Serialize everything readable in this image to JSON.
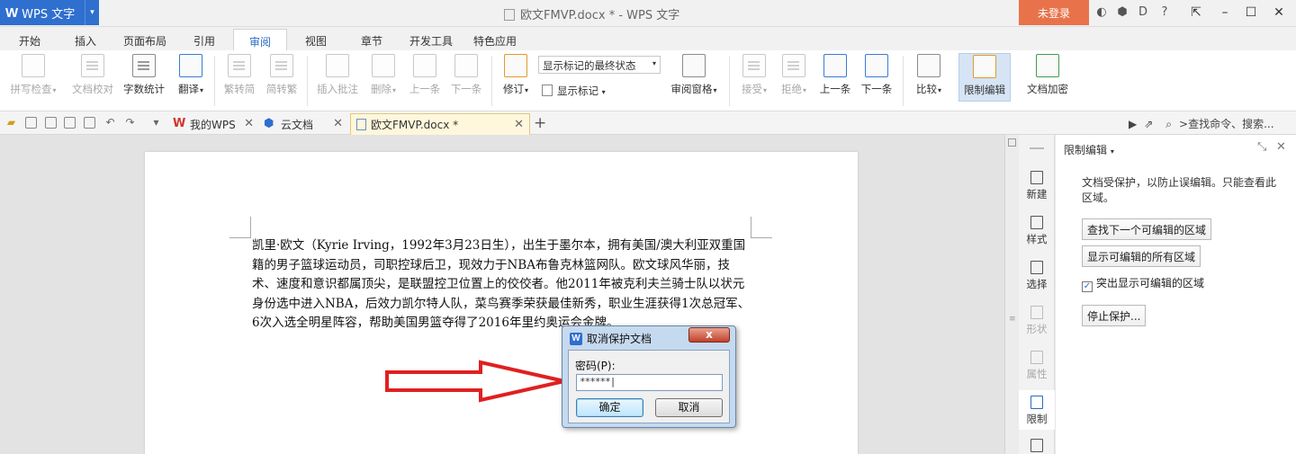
{
  "app": {
    "name": "WPS 文字",
    "logo": "W"
  },
  "window": {
    "title": "欧文FMVP.docx * - WPS 文字",
    "login": "未登录"
  },
  "menu": [
    "开始",
    "插入",
    "页面布局",
    "引用",
    "审阅",
    "视图",
    "章节",
    "开发工具",
    "特色应用"
  ],
  "menu_active": "审阅",
  "ribbon": {
    "spell": "拼写检查",
    "proof": "文档校对",
    "wordcount": "字数统计",
    "translate": "翻译",
    "to_simplified": "繁转简",
    "to_traditional": "简转繁",
    "insert_comment": "插入批注",
    "delete": "删除",
    "prev_comment": "上一条",
    "next_comment": "下一条",
    "revise": "修订",
    "display_state": "显示标记的最终状态",
    "show_markup": "显示标记",
    "review_pane": "审阅窗格",
    "accept": "接受",
    "reject": "拒绝",
    "prev_change": "上一条",
    "next_change": "下一条",
    "compare": "比较",
    "restrict_edit": "限制编辑",
    "encrypt": "文档加密"
  },
  "tabs": {
    "my_wps": "我的WPS",
    "cloud": "云文档",
    "doc": "欧文FMVP.docx *",
    "search": ">查找命令、搜索..."
  },
  "document": {
    "paragraph": "凯里·欧文（Kyrie Irving，1992年3月23日生），出生于墨尔本，拥有美国/澳大利亚双重国籍的男子篮球运动员，司职控球后卫，现效力于NBA布鲁克林篮网队。欧文球风华丽，技术、速度和意识都属顶尖，是联盟控卫位置上的佼佼者。他2011年被克利夫兰骑士队以状元身份选中进入NBA，后效力凯尔特人队，菜鸟赛季荣获最佳新秀，职业生涯获得1次总冠军、6次入选全明星阵容，帮助美国男篮夺得了2016年里约奥运会金牌。"
  },
  "sidestrip": [
    "新建",
    "样式",
    "选择",
    "形状",
    "属性",
    "限制"
  ],
  "panel": {
    "title": "限制编辑",
    "desc": "文档受保护，以防止误编辑。只能查看此区域。",
    "find_next": "查找下一个可编辑的区域",
    "show_all": "显示可编辑的所有区域",
    "highlight": "突出显示可编辑的区域",
    "stop": "停止保护..."
  },
  "dialog": {
    "title": "取消保护文档",
    "close": "x",
    "label": "密码(P):",
    "password": "******|",
    "ok": "确定",
    "cancel": "取消"
  },
  "colors": {
    "accent": "#2f6fcf",
    "login": "#e8734a",
    "arrow": "#e02020"
  }
}
